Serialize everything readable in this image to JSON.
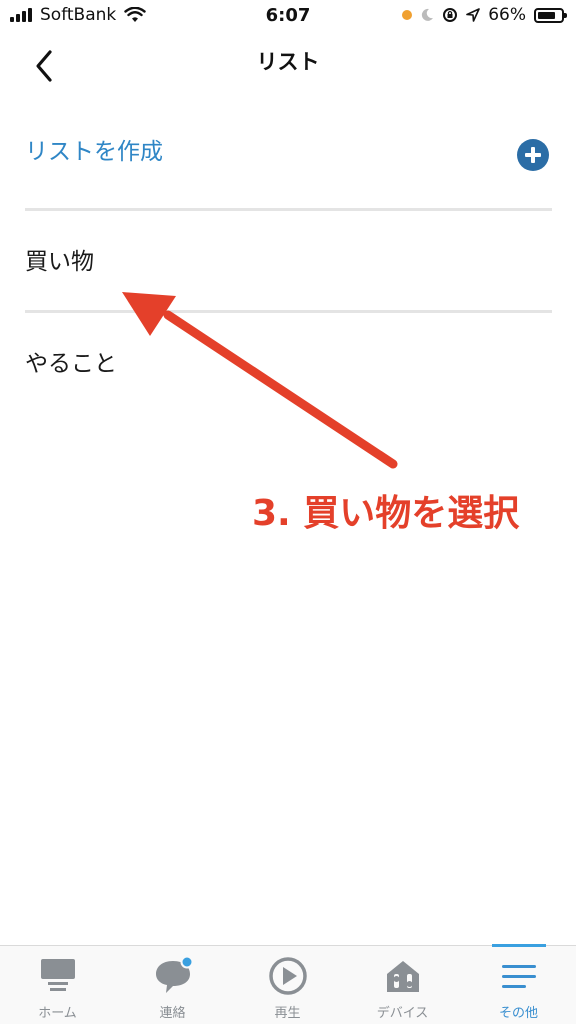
{
  "status_bar": {
    "carrier": "SoftBank",
    "time": "6:07",
    "battery": "66%"
  },
  "header": {
    "title": "リスト"
  },
  "list": {
    "create_label": "リストを作成",
    "items": [
      {
        "label": "買い物"
      },
      {
        "label": "やること"
      }
    ]
  },
  "annotation": {
    "text": "3. 買い物を選択",
    "color": "#e4402a"
  },
  "tab_bar": {
    "tabs": [
      {
        "label": "ホーム",
        "icon": "echo-device-icon"
      },
      {
        "label": "連絡",
        "icon": "chat-bubble-icon"
      },
      {
        "label": "再生",
        "icon": "play-icon"
      },
      {
        "label": "デバイス",
        "icon": "home-devices-icon"
      },
      {
        "label": "その他",
        "icon": "menu-lines-icon",
        "active": true
      }
    ]
  },
  "colors": {
    "accent": "#2f86c6",
    "plus_button": "#2b6da6",
    "tab_active": "#3a8fd0",
    "tab_inactive": "#8a8f94",
    "notification_dot": "#3aa0e0"
  }
}
